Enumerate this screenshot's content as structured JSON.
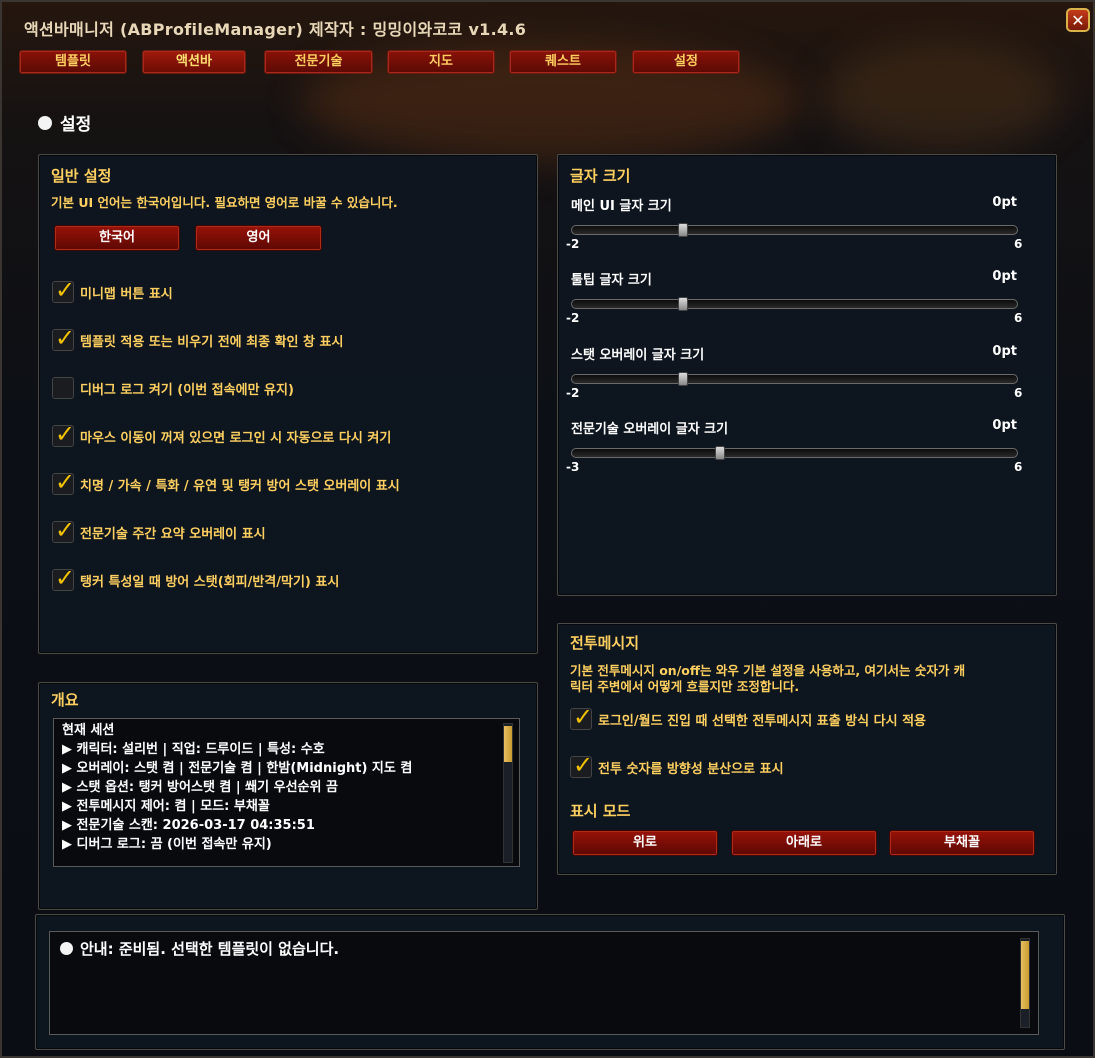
{
  "window": {
    "title": "액션바매니저 (ABProfileManager) 제작자 : 밍밍이와코코  v1.4.6",
    "close_label": "✕"
  },
  "tabs": [
    {
      "label": "템플릿",
      "active": false
    },
    {
      "label": "액션바",
      "active": true
    },
    {
      "label": "전문기술",
      "active": false
    },
    {
      "label": "지도",
      "active": false
    },
    {
      "label": "퀘스트",
      "active": false
    },
    {
      "label": "설정",
      "active": false
    }
  ],
  "section": {
    "title": "설정"
  },
  "general": {
    "title": "일반 설정",
    "desc": "기본 UI 언어는 한국어입니다. 필요하면 영어로 바꿀 수 있습니다.",
    "lang_buttons": [
      "한국어",
      "영어"
    ],
    "checkboxes": [
      {
        "label": "미니맵 버튼 표시",
        "checked": true
      },
      {
        "label": "템플릿 적용 또는 비우기 전에 최종 확인 창 표시",
        "checked": true
      },
      {
        "label": "디버그 로그 켜기 (이번 접속에만 유지)",
        "checked": false
      },
      {
        "label": "마우스 이동이 꺼져 있으면 로그인 시 자동으로 다시 켜기",
        "checked": true
      },
      {
        "label": "치명 / 가속 / 특화 / 유연 및 탱커 방어 스탯 오버레이 표시",
        "checked": true
      },
      {
        "label": "전문기술 주간 요약 오버레이 표시",
        "checked": true
      },
      {
        "label": "탱커 특성일 때 방어 스탯(회피/반격/막기) 표시",
        "checked": true
      }
    ]
  },
  "fontsize": {
    "title": "글자 크기",
    "sliders": [
      {
        "label": "메인 UI 글자 크기",
        "value": "0pt",
        "min": "-2",
        "max": "6",
        "level": 0.25
      },
      {
        "label": "툴팁 글자 크기",
        "value": "0pt",
        "min": "-2",
        "max": "6",
        "level": 0.25
      },
      {
        "label": "스탯 오버레이 글자 크기",
        "value": "0pt",
        "min": "-2",
        "max": "6",
        "level": 0.25
      },
      {
        "label": "전문기술 오버레이 글자 크기",
        "value": "0pt",
        "min": "-3",
        "max": "6",
        "level": 0.333
      }
    ]
  },
  "combat": {
    "title": "전투메시지",
    "desc_lines": [
      "기본 전투메시지 on/off는 와우 기본 설정을 사용하고, 여기서는 숫자가 캐",
      "릭터 주변에서 어떻게 흐를지만 조정합니다."
    ],
    "checkboxes": [
      {
        "label": "로그인/월드 진입 때 선택한 전투메시지 표출 방식 다시 적용",
        "checked": true
      },
      {
        "label": "전투 숫자를 방향성 분산으로 표시",
        "checked": true
      }
    ],
    "mode_title": "표시 모드",
    "mode_buttons": [
      "위로",
      "아래로",
      "부채꼴"
    ]
  },
  "overview": {
    "title": "개요",
    "lines": [
      "현재 세션",
      "▶ 캐릭터: 설리번 | 직업: 드루이드 | 특성: 수호",
      "▶ 오버레이: 스탯 켬 | 전문기술 켬 | 한밤(Midnight) 지도 켬",
      "▶ 스탯 옵션: 탱커 방어스탯 켬 | 쐐기 우선순위 끔",
      "▶ 전투메시지 제어: 켬 | 모드: 부채꼴",
      "▶ 전문기술 스캔: 2026-03-17 04:35:51",
      "▶ 디버그 로그: 끔 (이번 접속만 유지)"
    ]
  },
  "notice": {
    "text": "안내: 준비됨. 선택한 템플릿이 없습니다."
  },
  "colors": {
    "accent_gold": "#ffd060",
    "button_red": "#8a1208",
    "panel_bg": "#0e1620"
  }
}
